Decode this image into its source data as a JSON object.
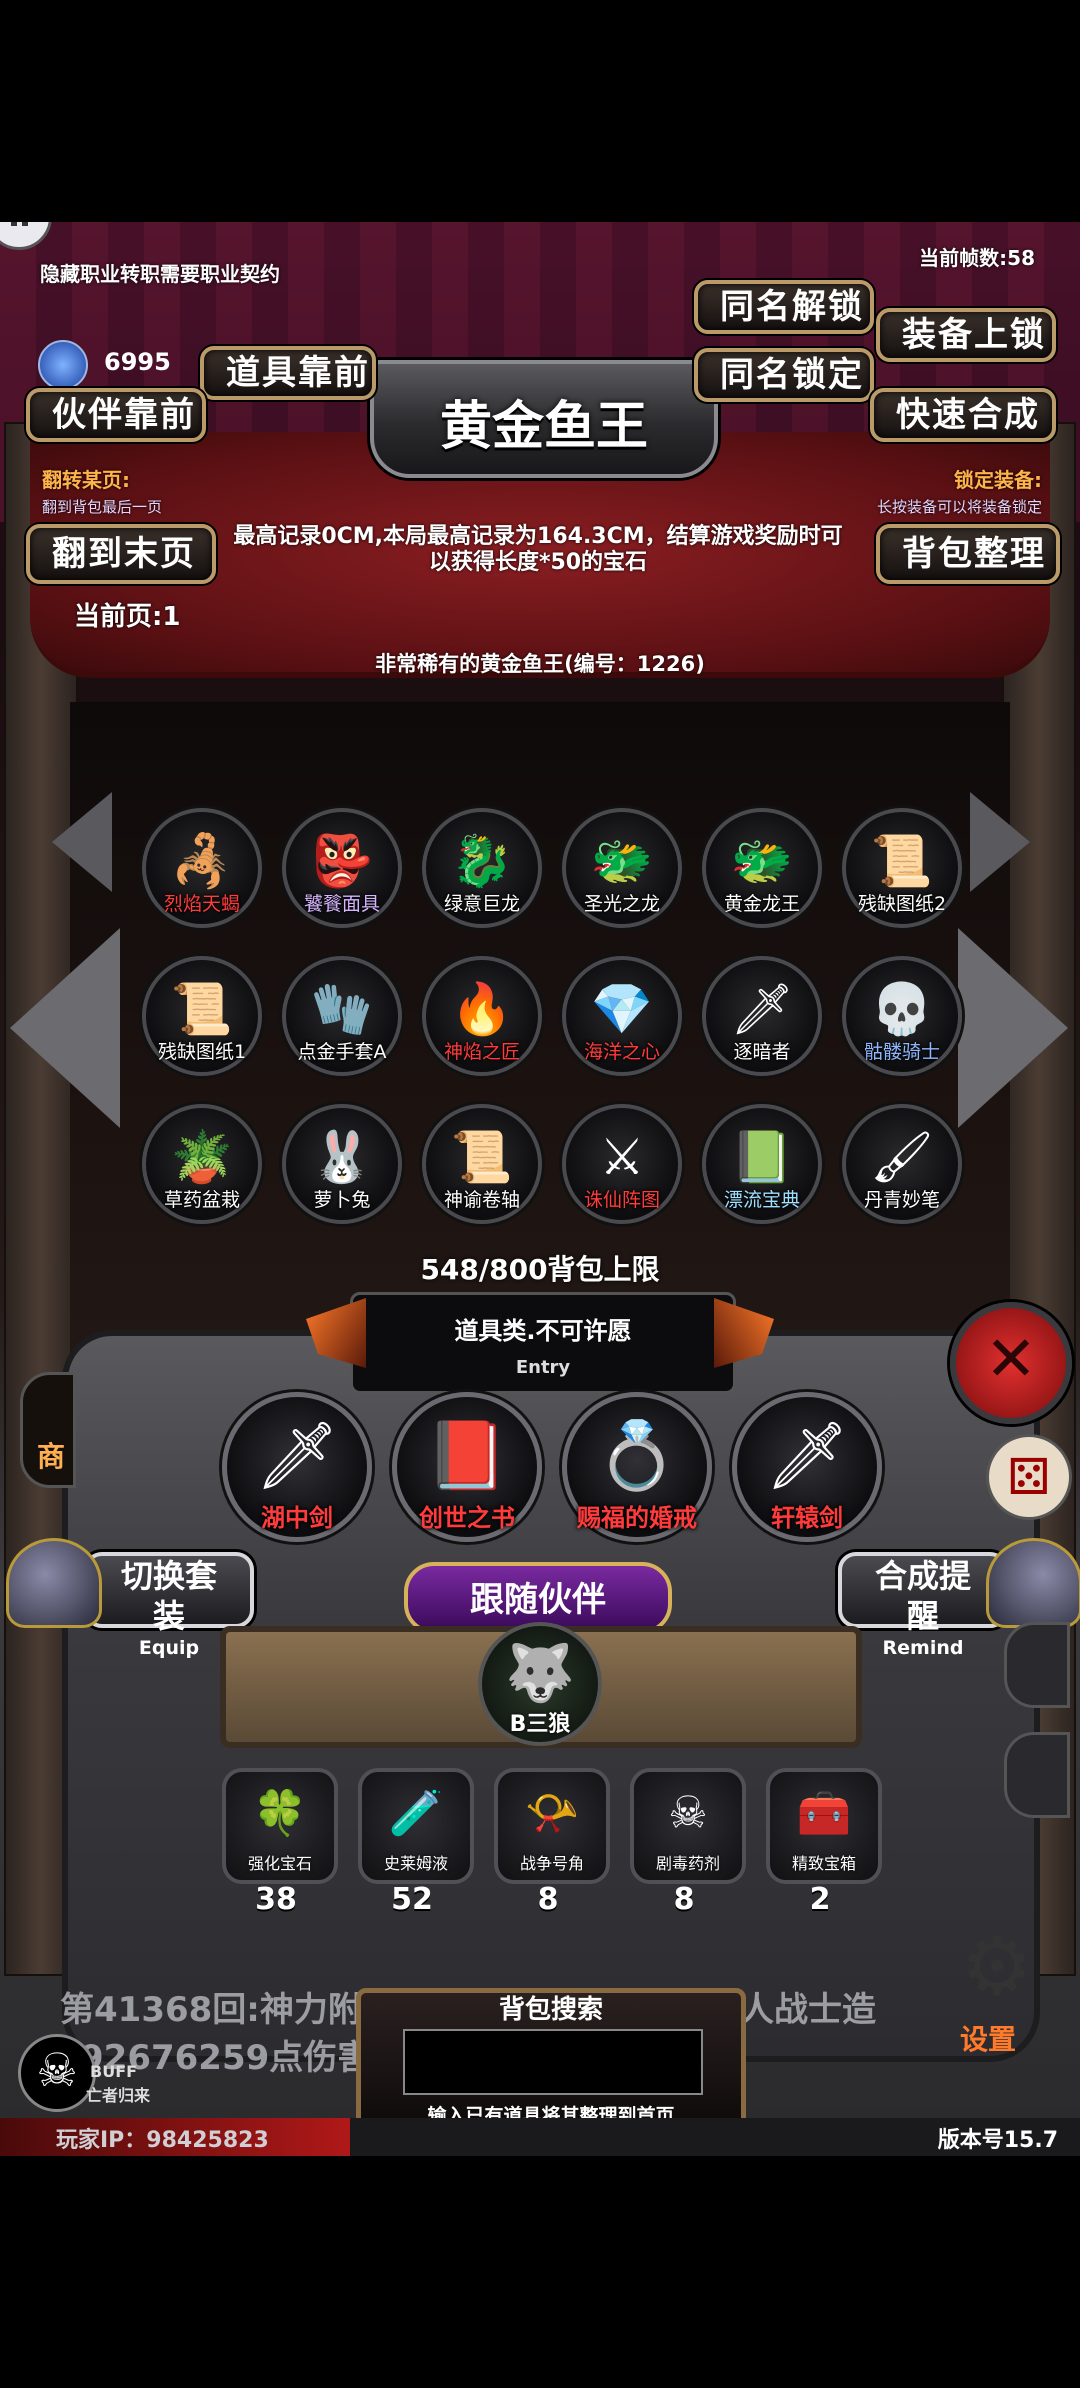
{
  "hud": {
    "fps": "当前帧数:58",
    "hint_top": "隐藏职业转职需要职业契约",
    "gem_count": "6995",
    "version": "版本号15.7",
    "player_ip": "玩家IP：98425823",
    "settings_label": "设置",
    "shop_label": "商"
  },
  "buttons": {
    "same_name_unlock": "同名解锁",
    "same_name_lock": "同名锁定",
    "equip_lock": "装备上锁",
    "quick_merge": "快速合成",
    "items_first": "道具靠前",
    "partner_first": "伙伴靠前",
    "go_last_page": "翻到末页",
    "sort_bag": "背包整理"
  },
  "title": "黄金鱼王",
  "notes": {
    "flip_title": "翻转某页:",
    "flip_desc": "翻到背包最后一页",
    "lock_title": "锁定装备:",
    "lock_desc": "长按装备可以将装备锁定",
    "current_page": "当前页:1"
  },
  "item_detail": {
    "record_text": "最高记录0CM,本局最高记录为164.3CM，结算游戏奖励时可以获得长度*50的宝石",
    "item_name": "非常稀有的黄金鱼王(编号：1226)"
  },
  "inventory": {
    "capacity": "548/800背包上限",
    "items": [
      {
        "label": "烈焰天蝎",
        "color": "red",
        "icon": "scorpion-icon",
        "glyph": "🦂"
      },
      {
        "label": "饕餮面具",
        "color": "purple",
        "icon": "mask-icon",
        "glyph": "👺"
      },
      {
        "label": "绿意巨龙",
        "color": "white",
        "icon": "green-dragon-icon",
        "glyph": "🐉"
      },
      {
        "label": "圣光之龙",
        "color": "white",
        "icon": "gold-dragon-icon",
        "glyph": "🐲"
      },
      {
        "label": "黄金龙王",
        "color": "white",
        "icon": "dragon-king-icon",
        "glyph": "🐲"
      },
      {
        "label": "残缺图纸2",
        "color": "white",
        "icon": "scroll-icon",
        "glyph": "📜"
      },
      {
        "label": "残缺图纸1",
        "color": "white",
        "icon": "scroll-icon",
        "glyph": "📜"
      },
      {
        "label": "点金手套A",
        "color": "white",
        "icon": "glove-icon",
        "glyph": "🧤"
      },
      {
        "label": "神焰之匠",
        "color": "red",
        "icon": "forge-icon",
        "glyph": "🔥"
      },
      {
        "label": "海洋之心",
        "color": "red",
        "icon": "ocean-gem-icon",
        "glyph": "💎"
      },
      {
        "label": "逐暗者",
        "color": "white",
        "icon": "spear-icon",
        "glyph": "🗡"
      },
      {
        "label": "骷髅骑士",
        "color": "blue",
        "icon": "skeleton-knight-icon",
        "glyph": "💀"
      },
      {
        "label": "草药盆栽",
        "color": "white",
        "icon": "potted-plant-icon",
        "glyph": "🪴"
      },
      {
        "label": "萝卜兔",
        "color": "white",
        "icon": "rabbit-icon",
        "glyph": "🐰"
      },
      {
        "label": "神谕卷轴",
        "color": "white",
        "icon": "scroll-icon",
        "glyph": "📜"
      },
      {
        "label": "诛仙阵图",
        "color": "red",
        "icon": "crossed-swords-icon",
        "glyph": "⚔"
      },
      {
        "label": "漂流宝典",
        "color": "cyan",
        "icon": "book-icon",
        "glyph": "📗"
      },
      {
        "label": "丹青妙笔",
        "color": "white",
        "icon": "brush-icon",
        "glyph": "🖌"
      }
    ]
  },
  "entry": {
    "title": "道具类.不可许愿",
    "subtitle": "Entry"
  },
  "equipped": [
    {
      "label": "湖中剑",
      "color": "#ff3b3b",
      "icon": "sword-icon",
      "glyph": "🗡"
    },
    {
      "label": "创世之书",
      "color": "#ff3b3b",
      "icon": "book-icon",
      "glyph": "📕"
    },
    {
      "label": "赐福的婚戒",
      "color": "#ff3b3b",
      "icon": "ring-icon",
      "glyph": "💍"
    },
    {
      "label": "轩辕剑",
      "color": "#ff3b3b",
      "icon": "blade-icon",
      "glyph": "🗡"
    }
  ],
  "switch_set": {
    "main": "切换套装",
    "sub": "Equip"
  },
  "merge_remind": {
    "main": "合成提醒",
    "sub": "Remind"
  },
  "follow_partner": {
    "title": "跟随伙伴",
    "name": "B三狼"
  },
  "consumables": [
    {
      "label": "强化宝石",
      "count": "38",
      "icon": "gem-icon",
      "glyph": "🍀"
    },
    {
      "label": "史莱姆液",
      "count": "52",
      "icon": "potion-icon",
      "glyph": "🧪"
    },
    {
      "label": "战争号角",
      "count": "8",
      "icon": "horn-icon",
      "glyph": "📯"
    },
    {
      "label": "剧毒药剂",
      "count": "8",
      "icon": "poison-icon",
      "glyph": "☠"
    },
    {
      "label": "精致宝箱",
      "count": "2",
      "icon": "chest-icon",
      "glyph": "🧰"
    }
  ],
  "search": {
    "title": "背包搜索",
    "hint": "输入已有道具将其整理到首页",
    "value": ""
  },
  "battle_log": {
    "line1": "第41368回:神力附",
    "line1b": "人战士造",
    "line2": "92676259点伤害"
  },
  "buff": {
    "label": "BUFF",
    "name": "亡者归来"
  }
}
